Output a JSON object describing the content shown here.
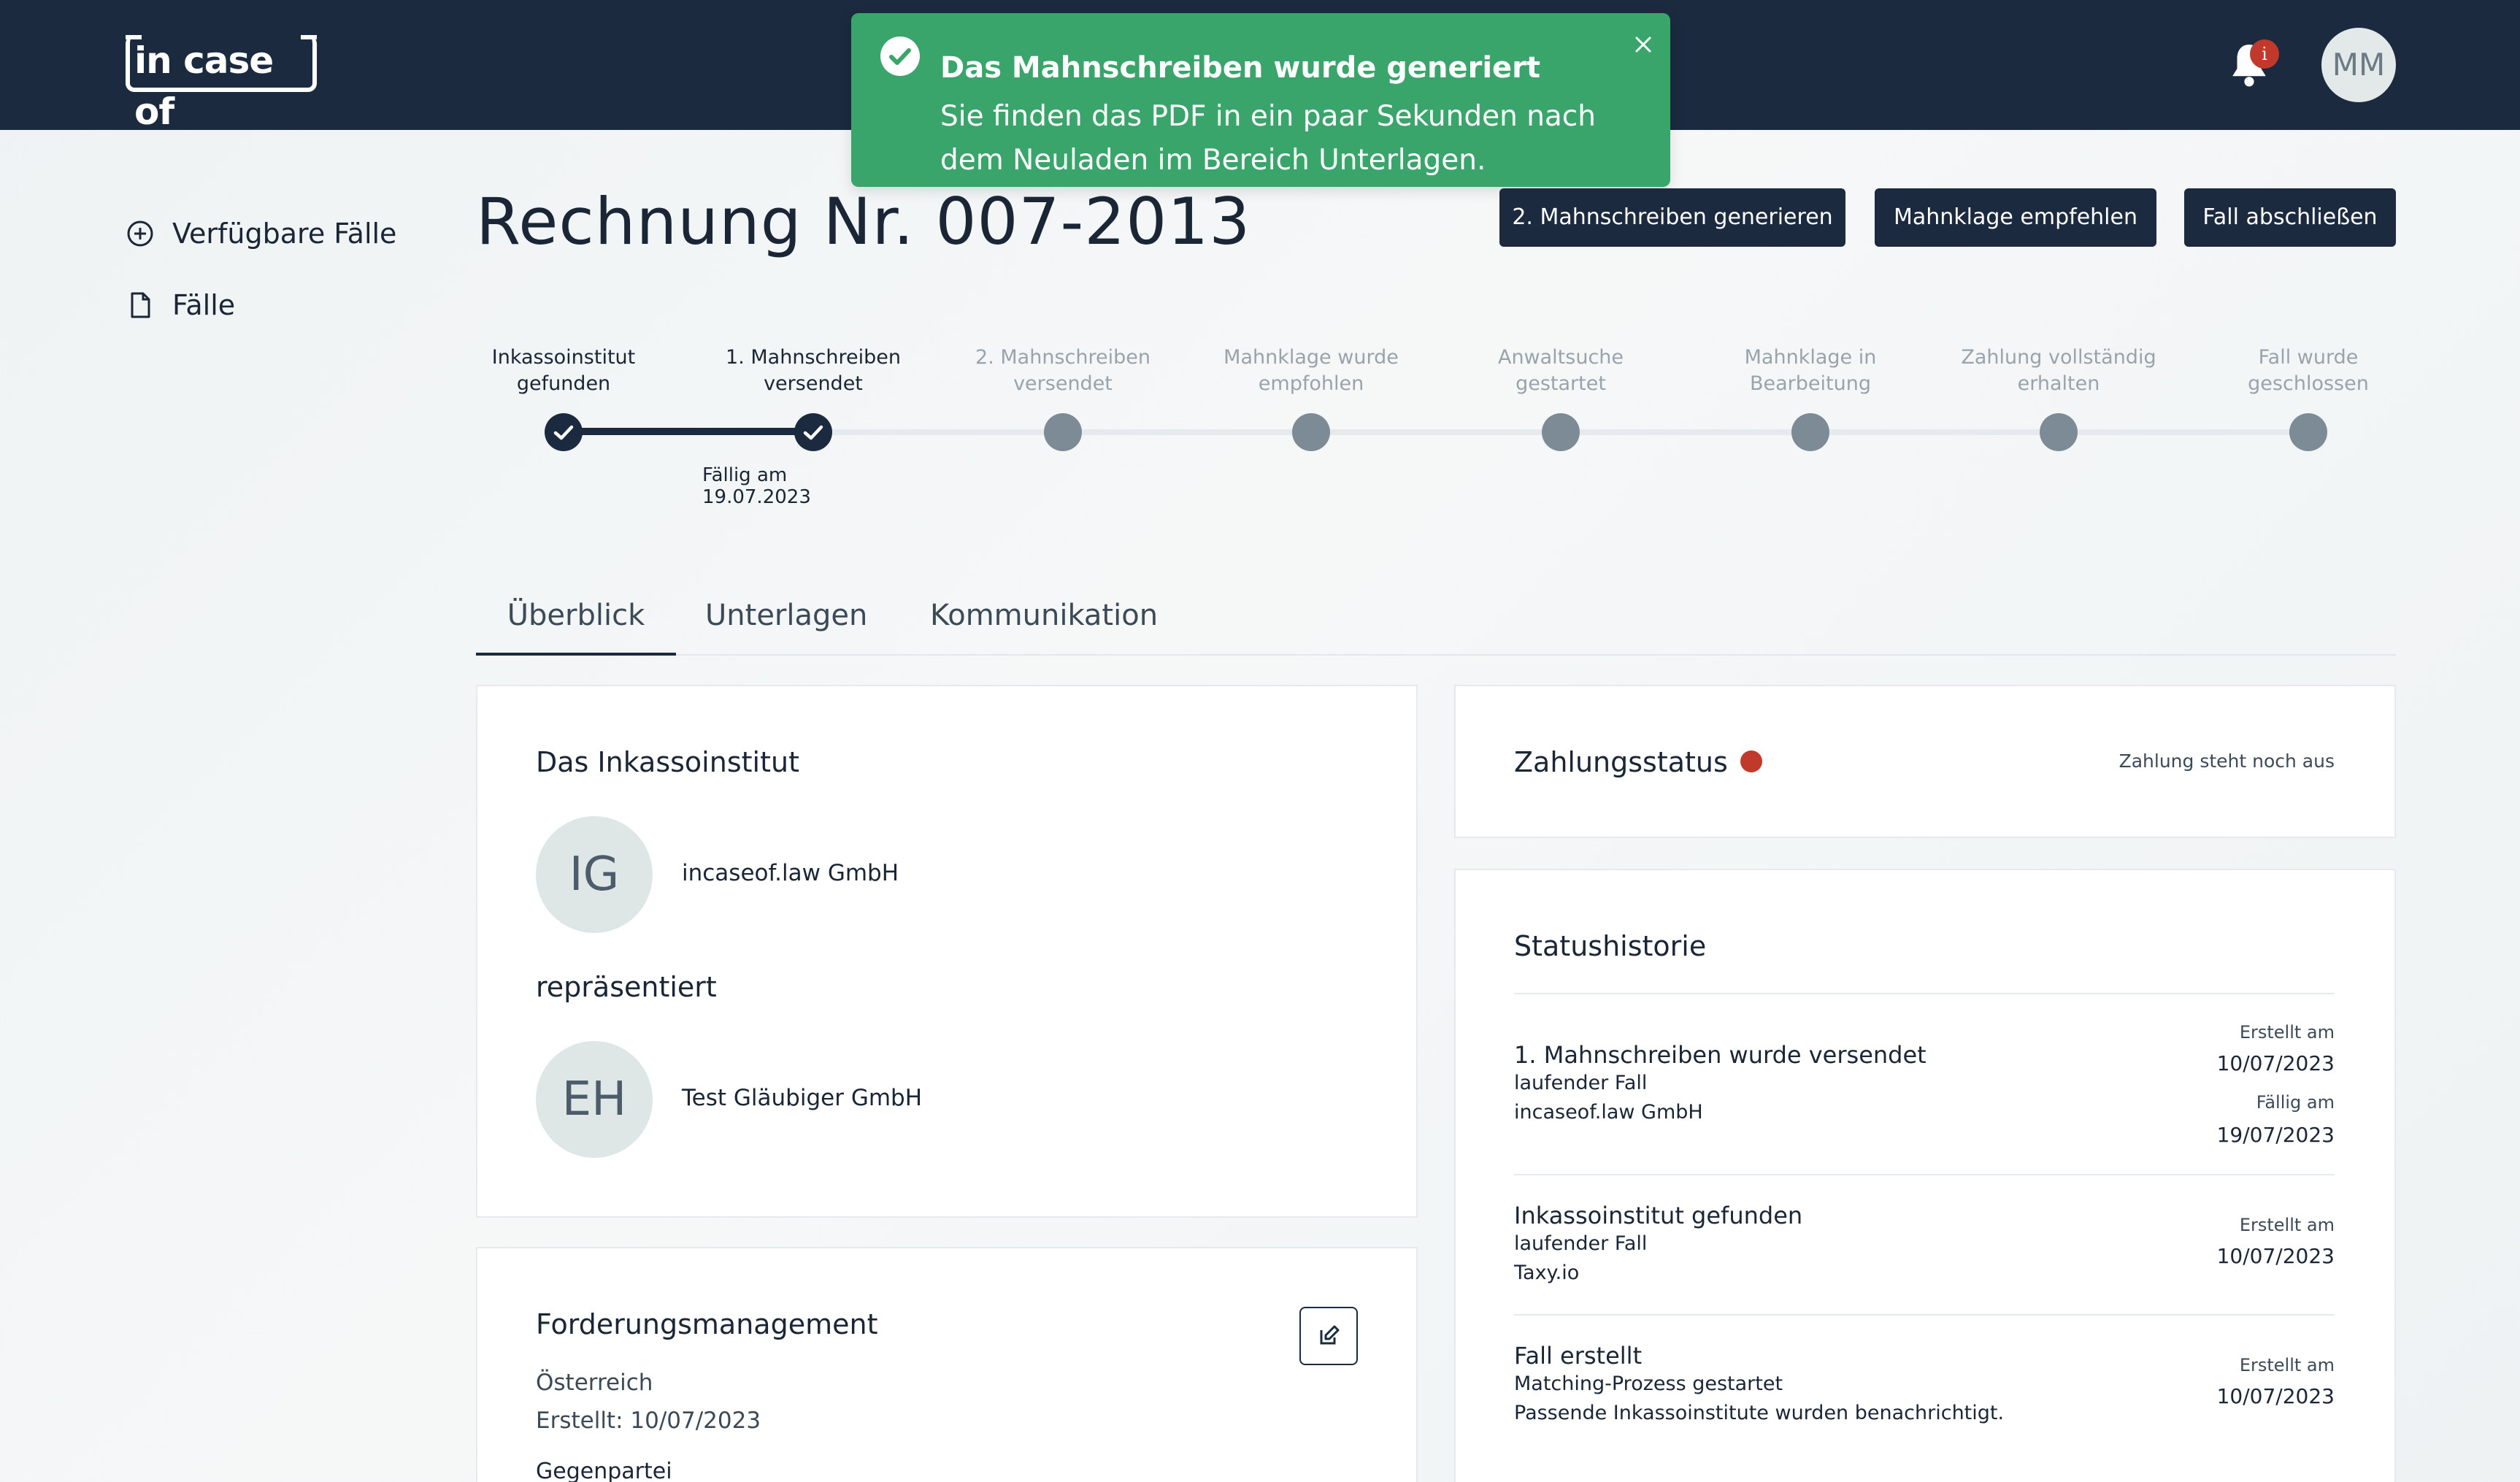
{
  "header": {
    "logo_text": "in case of",
    "notification_count": "i",
    "avatar_initials": "MM"
  },
  "toast": {
    "title": "Das Mahnschreiben wurde generiert",
    "message": "Sie finden das PDF in ein paar Sekunden nach dem Neuladen im Bereich Unterlagen."
  },
  "sidebar": {
    "items": [
      {
        "label": "Verfügbare Fälle",
        "icon": "plus-circle-icon"
      },
      {
        "label": "Fälle",
        "icon": "file-icon"
      }
    ]
  },
  "page": {
    "title": "Rechnung Nr. 007-2013",
    "actions": {
      "generate_label": "2. Mahnschreiben generieren",
      "recommend_label": "Mahnklage empfehlen",
      "close_label": "Fall abschließen"
    }
  },
  "stepper": {
    "steps": [
      {
        "line1": "Inkassoinstitut",
        "line2": "gefunden",
        "done": true
      },
      {
        "line1": "1. Mahnschreiben",
        "line2": "versendet",
        "done": true
      },
      {
        "line1": "2. Mahnschreiben",
        "line2": "versendet",
        "done": false
      },
      {
        "line1": "Mahnklage wurde",
        "line2": "empfohlen",
        "done": false
      },
      {
        "line1": "Anwaltsuche",
        "line2": "gestartet",
        "done": false
      },
      {
        "line1": "Mahnklage in",
        "line2": "Bearbeitung",
        "done": false
      },
      {
        "line1": "Zahlung vollständig",
        "line2": "erhalten",
        "done": false
      },
      {
        "line1": "Fall wurde",
        "line2": "geschlossen",
        "done": false
      }
    ],
    "due_note": "Fällig am 19.07.2023"
  },
  "tabs": [
    {
      "label": "Überblick",
      "active": true
    },
    {
      "label": "Unterlagen",
      "active": false
    },
    {
      "label": "Kommunikation",
      "active": false
    }
  ],
  "institute_card": {
    "heading": "Das Inkassoinstitut",
    "institute_initials": "IG",
    "institute_name": "incaseof.law GmbH",
    "represents_label": "repräsentiert",
    "creditor_initials": "EH",
    "creditor_name": "Test Gläubiger GmbH"
  },
  "claims_card": {
    "heading": "Forderungsmanagement",
    "country": "Österreich",
    "created": "Erstellt: 10/07/2023",
    "counterparty_label": "Gegenpartei"
  },
  "payment_card": {
    "heading": "Zahlungsstatus",
    "status_color": "#c0392b",
    "status_text": "Zahlung steht noch aus"
  },
  "history_card": {
    "heading": "Statushistorie",
    "entries": [
      {
        "title": "1. Mahnschreiben wurde versendet",
        "sub1": "laufender Fall",
        "sub2": "incaseof.law GmbH",
        "created_label": "Erstellt am",
        "created_date": "10/07/2023",
        "due_label": "Fällig am",
        "due_date": "19/07/2023"
      },
      {
        "title": "Inkassoinstitut gefunden",
        "sub1": "laufender Fall",
        "sub2": "Taxy.io",
        "created_label": "Erstellt am",
        "created_date": "10/07/2023"
      },
      {
        "title": "Fall erstellt",
        "sub1": "Matching-Prozess gestartet",
        "sub2": "Passende Inkassoinstitute wurden benachrichtigt.",
        "created_label": "Erstellt am",
        "created_date": "10/07/2023"
      }
    ]
  },
  "colors": {
    "navy": "#1b2a3e",
    "success": "#3aa56a",
    "danger": "#c0392b"
  }
}
